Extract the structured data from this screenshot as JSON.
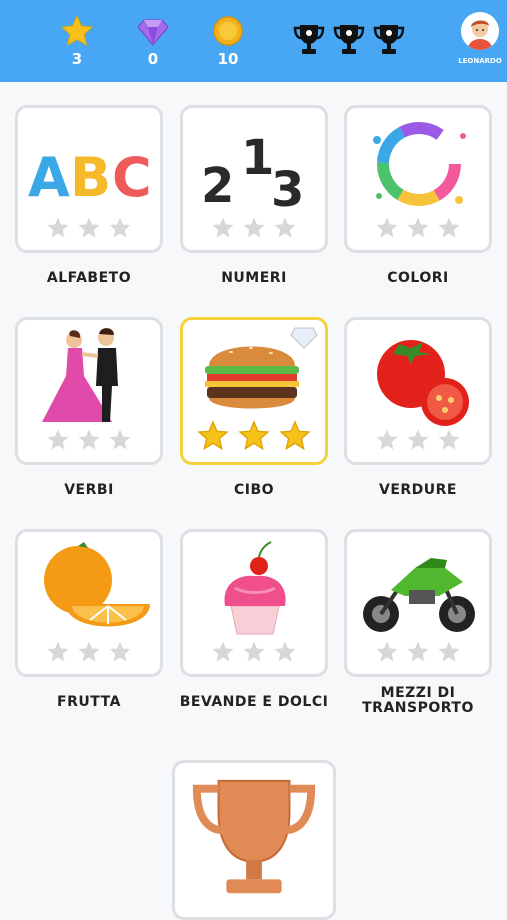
{
  "header": {
    "stars": "3",
    "gems": "0",
    "coins": "10",
    "user": "LEONARDO",
    "colors": {
      "bar": "#47a7f5",
      "star": "#f6c21a",
      "gem": "#9b59e6",
      "coin": "#f3b21b"
    }
  },
  "categories": [
    {
      "label": "ALFABETO",
      "art": "abc-letters",
      "stars_earned": 0
    },
    {
      "label": "NUMERI",
      "art": "numbers-213",
      "stars_earned": 0
    },
    {
      "label": "COLORI",
      "art": "color-splash-ring",
      "stars_earned": 0
    },
    {
      "label": "VERBI",
      "art": "dancing-couple",
      "stars_earned": 0
    },
    {
      "label": "CIBO",
      "art": "hamburger-diamond",
      "stars_earned": 3
    },
    {
      "label": "VERDURE",
      "art": "tomato",
      "stars_earned": 0
    },
    {
      "label": "FRUTTA",
      "art": "orange",
      "stars_earned": 0
    },
    {
      "label": "BEVANDE E DOLCI",
      "art": "cupcake",
      "stars_earned": 0
    },
    {
      "label": "MEZZI DI TRANSPORTO",
      "art": "motorbike",
      "stars_earned": 0
    }
  ],
  "trophy": {
    "art": "bronze-trophy"
  }
}
